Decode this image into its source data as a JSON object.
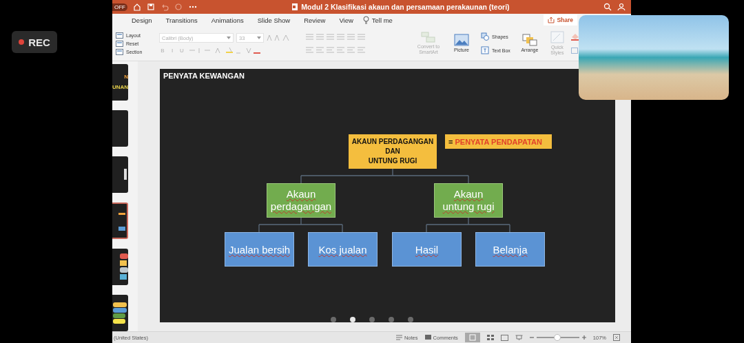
{
  "rec_badge": {
    "label": "REC"
  },
  "window": {
    "autosave": "OFF",
    "title": "Modul 2 Klasifikasi akaun dan persamaan perakaunan (teori)",
    "tabs": [
      {
        "label": "Design",
        "selected": false
      },
      {
        "label": "Transitions",
        "selected": false
      },
      {
        "label": "Animations",
        "selected": false
      },
      {
        "label": "Slide Show",
        "selected": false
      },
      {
        "label": "Review",
        "selected": false
      },
      {
        "label": "View",
        "selected": false
      }
    ],
    "tell_me": "Tell me",
    "share": "Share"
  },
  "ribbon": {
    "slide_commands": [
      "Layout",
      "Reset",
      "Section"
    ],
    "font": {
      "value": "Calibri (Body)",
      "disabled": true
    },
    "font_size": {
      "value": "33",
      "disabled": true
    },
    "format_buttons": [
      "B",
      "I",
      "U"
    ],
    "convert": "Convert to SmartArt",
    "picture": "Picture",
    "shapes": "Shapes",
    "text_box": "Text Box",
    "arrange": "Arrange",
    "quick_styles": "Quick Styles"
  },
  "thumbnails": [
    {
      "selected": false,
      "texts": [
        "N",
        "UNAN"
      ]
    },
    {
      "selected": false
    },
    {
      "selected": false
    },
    {
      "selected": true
    },
    {
      "selected": false
    },
    {
      "selected": false
    }
  ],
  "slide": {
    "title": "PENYATA KEWANGAN",
    "diagram": {
      "lines": [
        "AKAUN PERDAGANGAN",
        "DAN",
        "UNTUNG RUGI"
      ],
      "note": {
        "prefix": "=",
        "text": "PENYATA PENDAPATAN"
      },
      "children": [
        {
          "text": "Akaun perdagangan",
          "children": [
            {
              "text": "Jualan bersih"
            },
            {
              "text": "Kos jualan"
            }
          ]
        },
        {
          "text": "Akaun untung rugi",
          "children": [
            {
              "text": "Hasil"
            },
            {
              "text": "Belanja"
            }
          ]
        }
      ]
    },
    "pages": [
      {
        "selected": false
      },
      {
        "selected": true
      },
      {
        "selected": false
      },
      {
        "selected": false
      },
      {
        "selected": false
      }
    ]
  },
  "status_bar": {
    "language": "(United States)",
    "notes": "Notes",
    "comments": "Comments",
    "zoom": {
      "level": 0.48,
      "reading": "107%"
    }
  }
}
